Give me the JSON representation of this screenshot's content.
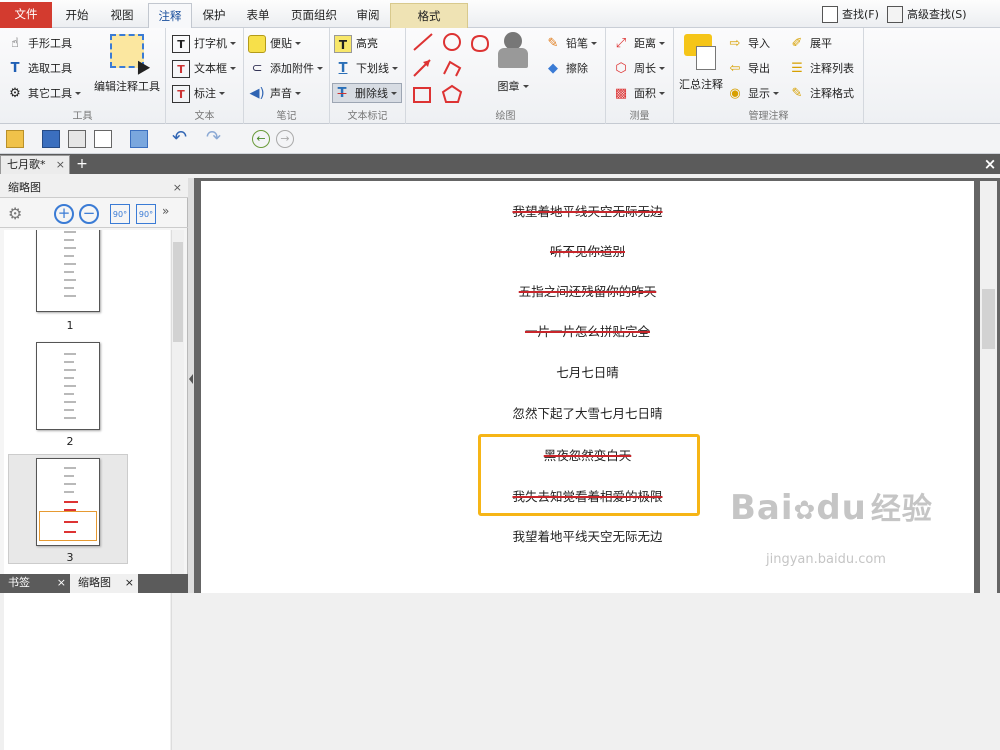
{
  "tabs": {
    "file": "文件",
    "items": [
      "开始",
      "视图",
      "注释",
      "保护",
      "表单",
      "页面组织",
      "审阅"
    ],
    "active": "注释",
    "context": "格式"
  },
  "search": {
    "find": "查找(F)",
    "advanced": "高级查找(S)"
  },
  "ribbon": {
    "tools": {
      "hand": "手形工具",
      "select_text": "选取工具",
      "other": "其它工具",
      "edit_annot": "编辑注释工具",
      "label": "工具"
    },
    "text": {
      "typewriter": "打字机",
      "textbox": "文本框",
      "callout": "标注",
      "label": "文本"
    },
    "note": {
      "sticky": "便贴",
      "attach": "添加附件",
      "sound": "声音",
      "label": "笔记"
    },
    "markup": {
      "highlight": "高亮",
      "underline": "下划线",
      "strikeout": "删除线",
      "label": "文本标记"
    },
    "drawing": {
      "stamp": "图章",
      "pencil": "铅笔",
      "eraser": "擦除",
      "label": "绘图"
    },
    "measure": {
      "distance": "距离",
      "perimeter": "周长",
      "area": "面积",
      "label": "测量"
    },
    "manage": {
      "summarize": "汇总注释",
      "import": "导入",
      "export": "导出",
      "show": "显示",
      "flatten": "展平",
      "list": "注释列表",
      "format": "注释格式",
      "label": "管理注释"
    }
  },
  "doc_tab": {
    "name": "七月歌*"
  },
  "panel": {
    "title": "缩略图",
    "pages": [
      "1",
      "2",
      "3"
    ],
    "bottom_tabs": [
      "书签",
      "缩略图"
    ]
  },
  "document": {
    "lines": [
      {
        "text": "我望着地平线天空无际无边",
        "strike": true
      },
      {
        "text": "听不见你道别",
        "strike": true
      },
      {
        "text": "五指之间还残留你的昨天",
        "strike": true
      },
      {
        "text": "一片一片怎么拼贴完全",
        "strike": true
      },
      {
        "text": "七月七日晴",
        "strike": false
      },
      {
        "text": "忽然下起了大雪七月七日晴",
        "strike": false
      },
      {
        "text": "黑夜忽然变白天",
        "strike": true
      },
      {
        "text": "我失去知觉看着相爱的极限",
        "strike": true
      },
      {
        "text": "我望着地平线天空无际无边",
        "strike": false
      }
    ]
  },
  "watermark": {
    "brand": "Bai",
    "brand2": "du",
    "cn": "经验",
    "url": "jingyan.baidu.com"
  },
  "colors": {
    "file_tab": "#d33b2f",
    "strike": "#c8262b",
    "highlight_box": "#f6b516"
  }
}
